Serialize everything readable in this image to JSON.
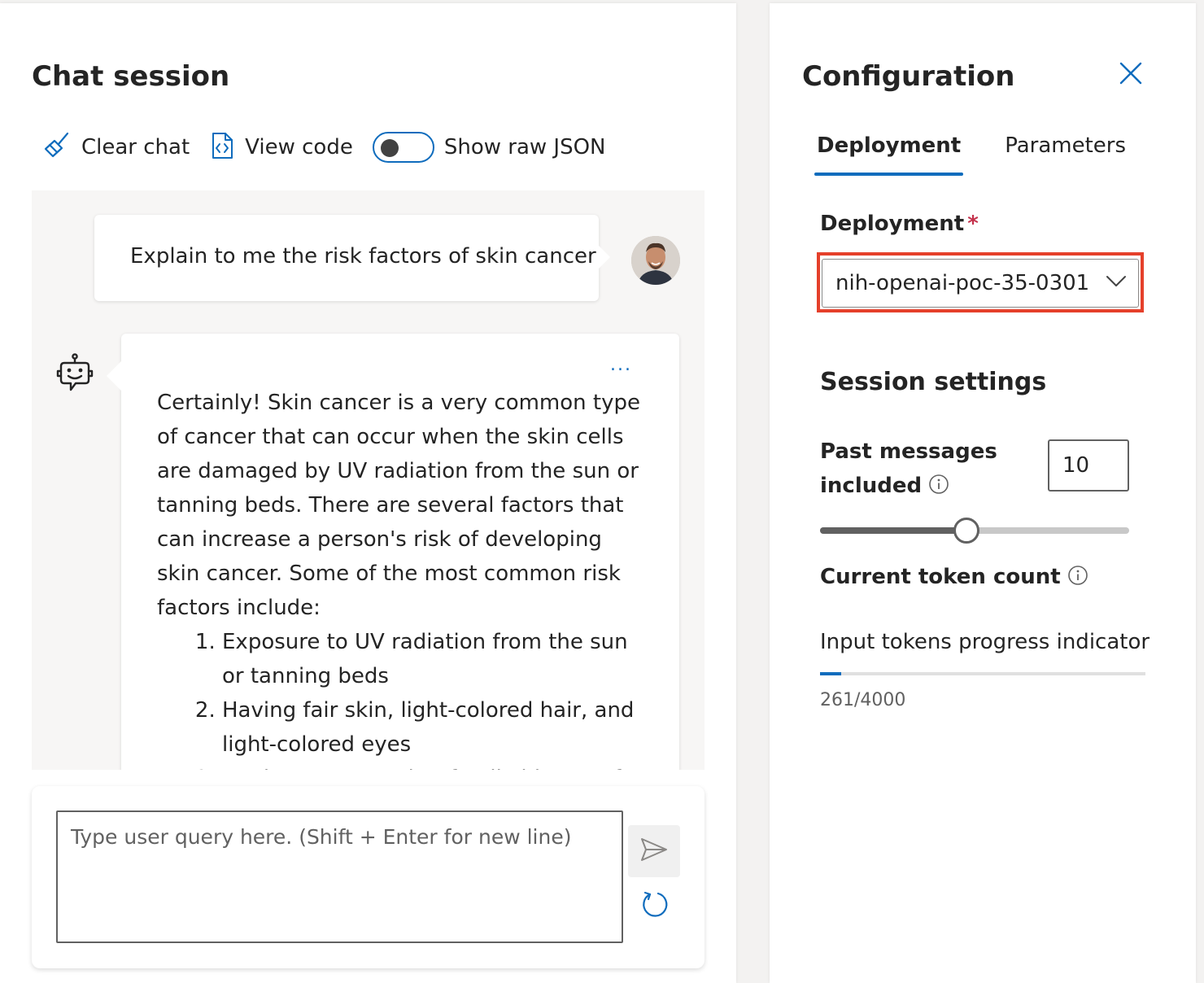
{
  "chat": {
    "title": "Chat session",
    "toolbar": {
      "clear_label": "Clear chat",
      "view_code_label": "View code",
      "raw_json_label": "Show raw JSON",
      "raw_json_on": false
    },
    "user_message": "Explain to me the risk factors of skin cancer",
    "assistant_message": {
      "more_label": "...",
      "intro": "Certainly! Skin cancer is a very common type of cancer that can occur when the skin cells are damaged by UV radiation from the sun or tanning beds. There are several factors that can increase a person's risk of developing skin cancer. Some of the most common risk factors include:",
      "items": [
        "Exposure to UV radiation from the sun or tanning beds",
        "Having fair skin, light-colored hair, and light-colored eyes",
        "Having a personal or family history of skin cancer"
      ]
    },
    "composer": {
      "placeholder": "Type user query here. (Shift + Enter for new line)"
    }
  },
  "config": {
    "title": "Configuration",
    "tabs": [
      {
        "label": "Deployment",
        "active": true
      },
      {
        "label": "Parameters",
        "active": false
      }
    ],
    "deployment_label": "Deployment",
    "required_mark": "*",
    "deployment_value": "nih-openai-poc-35-0301",
    "session_settings_title": "Session settings",
    "past_messages_label_line1": "Past messages",
    "past_messages_label_line2": "included",
    "past_messages_value": "10",
    "past_messages_slider_fraction": 0.47,
    "token_count_label": "Current token count",
    "progress_label": "Input tokens progress indicator",
    "progress_count": "261/4000",
    "progress_fraction": 0.065
  },
  "colors": {
    "accent": "#0f6cbd",
    "highlight_box": "#e5402b",
    "required": "#c4314b"
  }
}
